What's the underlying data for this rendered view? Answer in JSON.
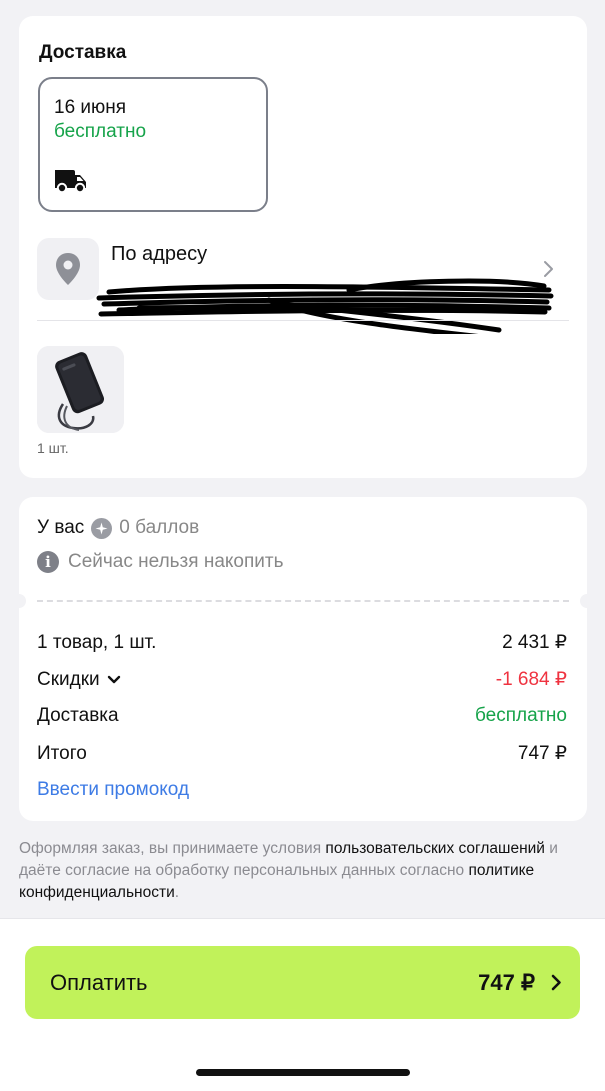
{
  "delivery": {
    "title": "Доставка",
    "option": {
      "date": "16 июня",
      "price": "бесплатно",
      "icon": "truck-icon"
    },
    "address": {
      "title": "По адресу",
      "subtitle": "",
      "icon": "location-pin-icon",
      "chevron_icon": "chevron-right-icon"
    },
    "items": [
      {
        "image": "power-bank",
        "qty": "1 шт."
      }
    ]
  },
  "bonus": {
    "prefix": "У вас",
    "points": "0 баллов",
    "note": "Сейчас нельзя накопить"
  },
  "summary": {
    "goods_label": "1 товар, 1 шт.",
    "goods_value": "2 431 ₽",
    "discount_label": "Скидки",
    "discount_value": "-1 684 ₽",
    "delivery_label": "Доставка",
    "delivery_value": "бесплатно",
    "total_label": "Итого",
    "total_value": "747 ₽",
    "promo_link": "Ввести промокод"
  },
  "legal": {
    "part1": "Оформляя заказ, вы принимаете условия ",
    "link1": "пользовательских соглашений",
    "part2": " и даёте согласие на обработку персональных данных согласно ",
    "link2": "политике конфиденциальности",
    "part3": "."
  },
  "pay_button": {
    "label": "Оплатить",
    "amount": "747 ₽"
  },
  "colors": {
    "accent": "#c1f25a",
    "green": "#16a34a",
    "red": "#ef3340",
    "link": "#3d7be5"
  }
}
